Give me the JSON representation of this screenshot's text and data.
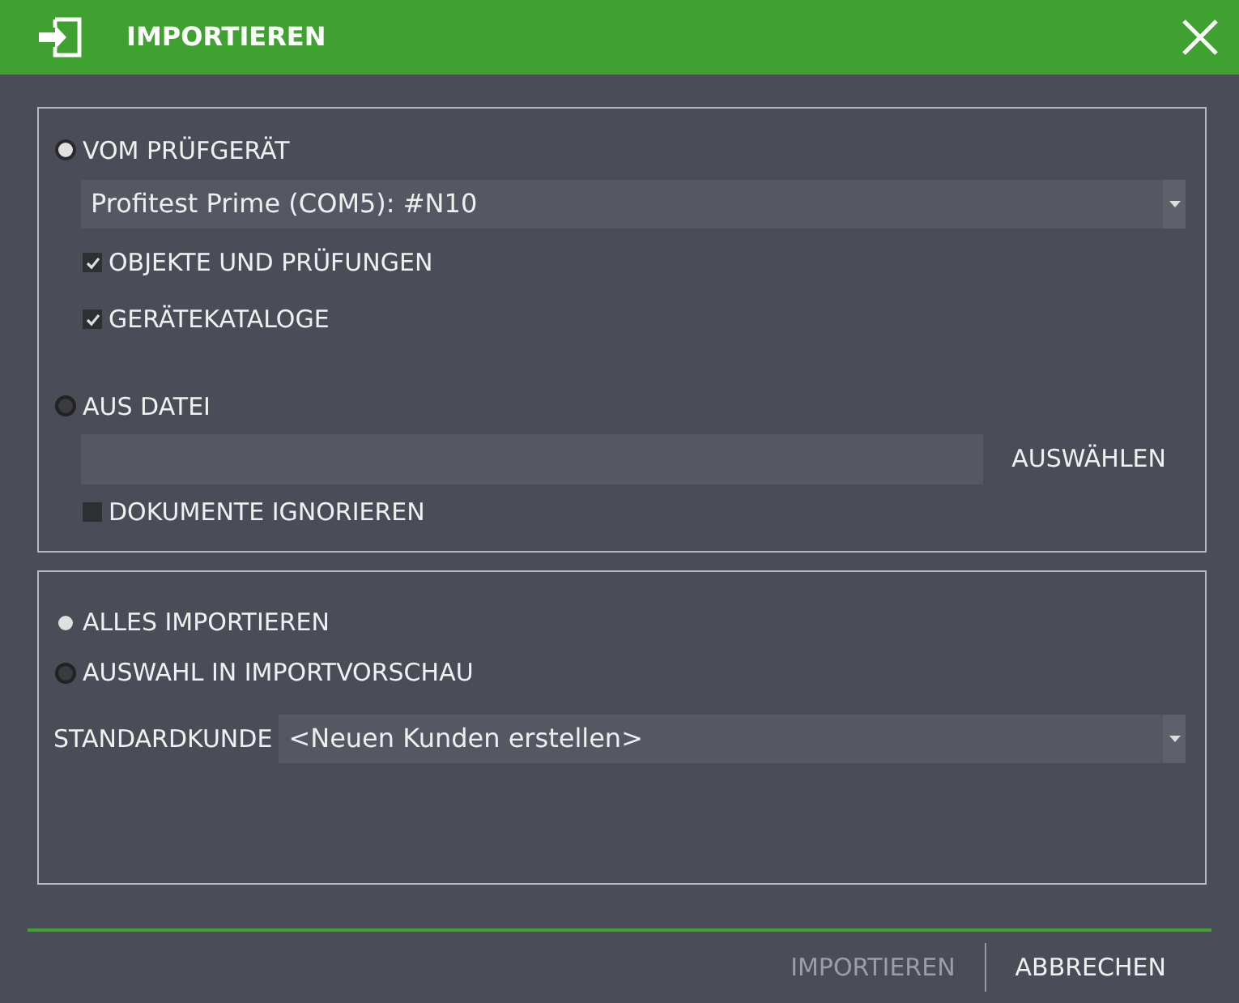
{
  "window": {
    "title": "IMPORTIEREN"
  },
  "source": {
    "options": [
      {
        "kind": "device",
        "label": "VOM PRÜFGERÄT",
        "selected": true,
        "device": "Profitest Prime (COM5): #N10",
        "checks": [
          {
            "label": "OBJEKTE UND PRÜFUNGEN",
            "checked": true
          },
          {
            "label": "GERÄTEKATALOGE",
            "checked": true
          }
        ]
      },
      {
        "kind": "file",
        "label": "AUS DATEI",
        "selected": false,
        "button": "AUSWÄHLEN",
        "checks": [
          {
            "label": "DOKUMENTE IGNORIEREN",
            "checked": false
          }
        ]
      }
    ]
  },
  "mode": {
    "options": [
      {
        "label": "ALLES IMPORTIEREN",
        "selected": true
      },
      {
        "label": "AUSWAHL IN IMPORTVORSCHAU",
        "selected": false
      }
    ],
    "customer_label": "STANDARDKUNDE",
    "customer": "<Neuen Kunden erstellen>"
  },
  "buttons": [
    {
      "label": "IMPORTIEREN",
      "disabled": true
    },
    {
      "label": "ABBRECHEN",
      "disabled": false
    }
  ]
}
